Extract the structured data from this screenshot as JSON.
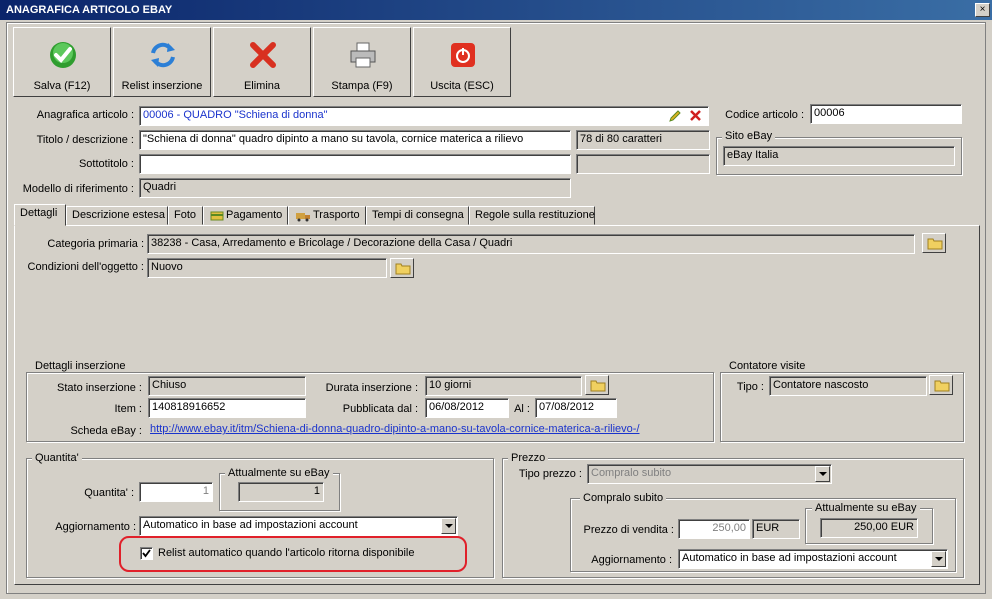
{
  "window": {
    "title": "ANAGRAFICA ARTICOLO EBAY",
    "close": "×"
  },
  "toolbar": {
    "save": "Salva (F12)",
    "relist": "Relist inserzione",
    "delete": "Elimina",
    "print": "Stampa (F9)",
    "exit": "Uscita (ESC)"
  },
  "header": {
    "anagrafica_label": "Anagrafica articolo :",
    "anagrafica_value": "00006 - QUADRO \"Schiena di donna\"",
    "codice_label": "Codice articolo :",
    "codice_value": "00006",
    "titolo_label": "Titolo / descrizione :",
    "titolo_value": "\"Schiena di donna\" quadro dipinto a mano su tavola, cornice materica a rilievo",
    "char_count": "78 di 80 caratteri",
    "sottotitolo_label": "Sottotitolo :",
    "sottotitolo_value": "",
    "modello_label": "Modello di riferimento :",
    "modello_value": "Quadri",
    "sito_title": "Sito eBay",
    "sito_value": "eBay Italia"
  },
  "tabs": [
    "Dettagli",
    "Descrizione estesa",
    "Foto",
    "Pagamento",
    "Trasporto",
    "Tempi di consegna",
    "Regole sulla restituzione"
  ],
  "details": {
    "categoria_label": "Categoria primaria :",
    "categoria_value": "38238 - Casa, Arredamento e Bricolage / Decorazione della Casa / Quadri",
    "condizioni_label": "Condizioni dell'oggetto :",
    "condizioni_value": "Nuovo"
  },
  "inserzione": {
    "title": "Dettagli inserzione",
    "stato_label": "Stato inserzione :",
    "stato_value": "Chiuso",
    "durata_label": "Durata inserzione :",
    "durata_value": "10 giorni",
    "item_label": "Item :",
    "item_value": "140818916652",
    "pubblicata_label": "Pubblicata dal :",
    "pubblicata_value": "06/08/2012",
    "al_label": "Al :",
    "al_value": "07/08/2012",
    "scheda_label": "Scheda eBay :",
    "scheda_url": "http://www.ebay.it/itm/Schiena-di-donna-quadro-dipinto-a-mano-su-tavola-cornice-materica-a-rilievo-/"
  },
  "contatore": {
    "title": "Contatore visite",
    "tipo_label": "Tipo :",
    "tipo_value": "Contatore nascosto"
  },
  "quantita": {
    "title": "Quantita'",
    "label": "Quantita' :",
    "value": "1",
    "ebay_title": "Attualmente su eBay",
    "ebay_value": "1",
    "aggiornamento_label": "Aggiornamento :",
    "aggiornamento_value": "Automatico in base ad impostazioni account",
    "relist_label": "Relist automatico quando l'articolo ritorna disponibile"
  },
  "prezzo": {
    "title": "Prezzo",
    "tipo_label": "Tipo prezzo :",
    "tipo_value": "Compralo subito",
    "compralo_title": "Compralo subito",
    "vendita_label": "Prezzo di vendita :",
    "vendita_value": "250,00",
    "currency": "EUR",
    "ebay_title": "Attualmente su eBay",
    "ebay_value": "250,00 EUR",
    "aggiornamento_label": "Aggiornamento :",
    "aggiornamento_value": "Automatico in base ad impostazioni account"
  },
  "colors": {
    "titlebar": "#0a246a",
    "highlight": "#e0202a",
    "link": "#1a33cc"
  }
}
